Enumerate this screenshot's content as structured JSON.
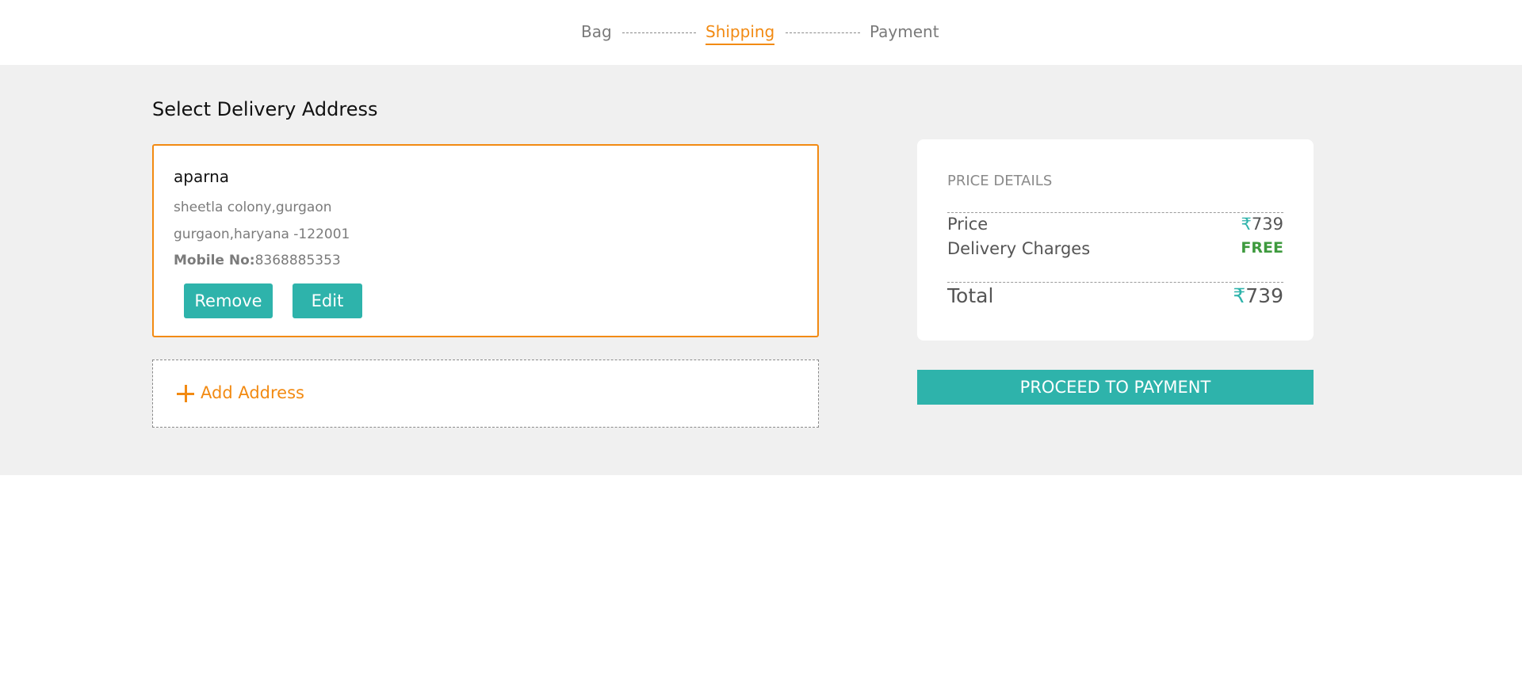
{
  "stepper": {
    "steps": [
      {
        "label": "Bag",
        "active": false
      },
      {
        "label": "Shipping",
        "active": true
      },
      {
        "label": "Payment",
        "active": false
      }
    ]
  },
  "address_section": {
    "title": "Select Delivery Address",
    "selected_address": {
      "name": "aparna",
      "line1": "sheetla colony,gurgaon",
      "line2": "gurgaon,haryana -122001",
      "mobile_label": "Mobile No:",
      "mobile_value": "8368885353",
      "remove_label": "Remove",
      "edit_label": "Edit"
    },
    "add_address_label": "Add Address"
  },
  "price_details": {
    "title": "PRICE DETAILS",
    "currency_symbol": "₹",
    "rows": [
      {
        "label": "Price",
        "value": "739"
      },
      {
        "label": "Delivery Charges",
        "value": "FREE"
      }
    ],
    "total_label": "Total",
    "total_value": "739"
  },
  "proceed_label": "PROCEED TO PAYMENT",
  "colors": {
    "accent_orange": "#f28a12",
    "accent_teal": "#2eb3ab",
    "free_green": "#3e9a3e",
    "section_bg": "#f0f0f0"
  }
}
